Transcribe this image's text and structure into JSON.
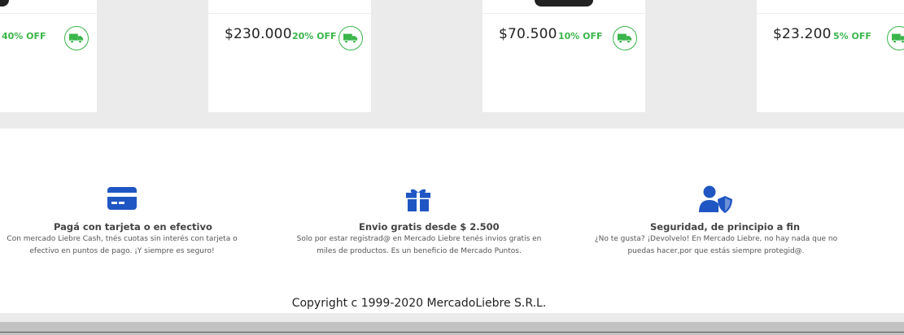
{
  "products": [
    {
      "price": "",
      "off": "40% OFF"
    },
    {
      "price": "$230.000",
      "off": "20% OFF"
    },
    {
      "price": "$70.500",
      "off": "10% OFF"
    },
    {
      "price": "$23.200",
      "off": "5% OFF"
    }
  ],
  "features": [
    {
      "icon": "credit-card-icon",
      "title": "Pagá con tarjeta o en efectivo",
      "line1": "Con mercado Liebre Cash, tnés cuotas sin interés con tarjeta o",
      "line2": "efectivo en puntos de pago. ¡Y siempre es seguro!"
    },
    {
      "icon": "gift-icon",
      "title": "Envio gratis desde $ 2.500",
      "line1": "Solo por estar registrad@ en Mercado Liebre tenés invios gratis en",
      "line2": "miles de productos. Es un beneficio de Mercado Puntos."
    },
    {
      "icon": "user-shield-icon",
      "title": "Seguridad, de principio a fin",
      "line1": "¿No te gusta? ¡Devolvelo! En Mercado Liebre, no hay nada que no",
      "line2": "puedas hacer,por que estás siempre protegid@."
    }
  ],
  "footer": {
    "copyright": "Copyright c 1999-2020 MercadoLiebre S.R.L."
  },
  "colors": {
    "accent": "#3483fa",
    "icon_blue": "#1f56c3",
    "discount_green": "#39b54a"
  }
}
